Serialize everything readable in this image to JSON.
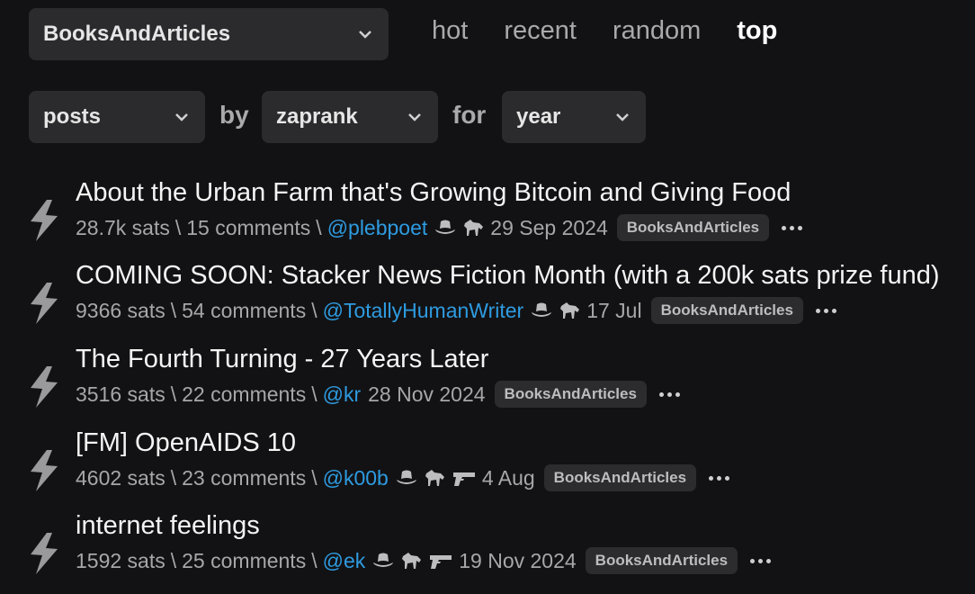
{
  "header": {
    "sub_select": "BooksAndArticles",
    "tabs": [
      {
        "label": "hot",
        "active": false
      },
      {
        "label": "recent",
        "active": false
      },
      {
        "label": "random",
        "active": false
      },
      {
        "label": "top",
        "active": true
      }
    ]
  },
  "filters": {
    "type": "posts",
    "by_word": "by",
    "by": "zaprank",
    "for_word": "for",
    "period": "year"
  },
  "posts": [
    {
      "title": "About the Urban Farm that's Growing Bitcoin and Giving Food",
      "sats": "28.7k sats",
      "comments": "15 comments",
      "user": "@plebpoet",
      "hats": [
        "cowboy-hat-icon",
        "horse-icon"
      ],
      "date": "29 Sep 2024",
      "sub": "BooksAndArticles"
    },
    {
      "title": "COMING SOON: Stacker News Fiction Month (with a 200k sats prize fund)",
      "sats": "9366 sats",
      "comments": "54 comments",
      "user": "@TotallyHumanWriter",
      "hats": [
        "cowboy-hat-icon",
        "horse-icon"
      ],
      "date": "17 Jul",
      "sub": "BooksAndArticles"
    },
    {
      "title": "The Fourth Turning - 27 Years Later",
      "sats": "3516 sats",
      "comments": "22 comments",
      "user": "@kr",
      "hats": [],
      "date": "28 Nov 2024",
      "sub": "BooksAndArticles"
    },
    {
      "title": "[FM] OpenAIDS 10",
      "sats": "4602 sats",
      "comments": "23 comments",
      "user": "@k00b",
      "hats": [
        "cowboy-hat-icon",
        "horse-icon",
        "gun-icon"
      ],
      "date": "4 Aug",
      "sub": "BooksAndArticles"
    },
    {
      "title": "internet feelings",
      "sats": "1592 sats",
      "comments": "25 comments",
      "user": "@ek",
      "hats": [
        "cowboy-hat-icon",
        "horse-icon",
        "gun-icon"
      ],
      "date": "19 Nov 2024",
      "sub": "BooksAndArticles"
    }
  ],
  "meta_separator": "\\"
}
